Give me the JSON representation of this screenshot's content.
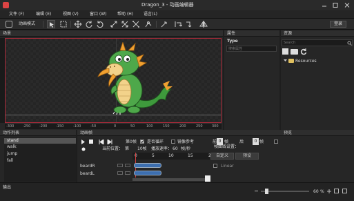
{
  "window": {
    "title": "Dragon_3 - 动画编辑器"
  },
  "menu": [
    "文件 (F)",
    "编辑 (E)",
    "视图 (V)",
    "窗口 (W)",
    "帮助 (H)",
    "语言(L)"
  ],
  "toolbar": {
    "mode_label": "动画模式",
    "login_label": "登录",
    "icons": [
      "select-icon",
      "transform-icon",
      "move-icon",
      "rotate-left-icon",
      "rotate-right-icon",
      "scale-icon",
      "distort-icon",
      "bone-icon",
      "ik-icon",
      "link-icon",
      "unlink-icon",
      "pin-icon",
      "flip-icon"
    ]
  },
  "scene": {
    "label": "场景",
    "ruler_ticks": [
      "-300",
      "-250",
      "-200",
      "-150",
      "-100",
      "-50",
      "0",
      "50",
      "100",
      "150",
      "200",
      "250",
      "300"
    ]
  },
  "properties": {
    "label": "属性",
    "type_label": "Type",
    "search_placeholder": "搜索属性"
  },
  "resources": {
    "label": "资源",
    "search_placeholder": "Search",
    "tree_root": "Resources"
  },
  "actions": {
    "label": "动作列表",
    "items": [
      {
        "label": "stand",
        "selected": true
      },
      {
        "label": "walk",
        "selected": false
      },
      {
        "label": "jump",
        "selected": false
      },
      {
        "label": "fall",
        "selected": false
      }
    ]
  },
  "frames": {
    "label": "动画帧",
    "frame_label": "第0帧",
    "loop_label": "是否循环",
    "loop_checked": true,
    "mirror_label": "镜像参考",
    "prev_label": "前",
    "prev_value": "0",
    "frame_unit_prev": "帧",
    "next_label": "后",
    "next_value": "0",
    "frame_unit_next": "帧",
    "current_pos_label": "当前位置：",
    "current_pos_value": "第",
    "frames_count": "10帧",
    "fps_label": "播放速率：",
    "fps_value": "60",
    "fps_unit": "帧/秒",
    "curve_label": "帧曲线设置：",
    "timeline_ticks": [
      "0",
      "5",
      "10",
      "15",
      "2"
    ],
    "tracks": [
      "beardR",
      "beardL"
    ]
  },
  "preview": {
    "label": "预览",
    "custom_label": "自定义",
    "preset_label": "预设",
    "curve_value": "Linear"
  },
  "output": {
    "label": "输出",
    "zoom_value": "60",
    "zoom_unit": "%"
  }
}
